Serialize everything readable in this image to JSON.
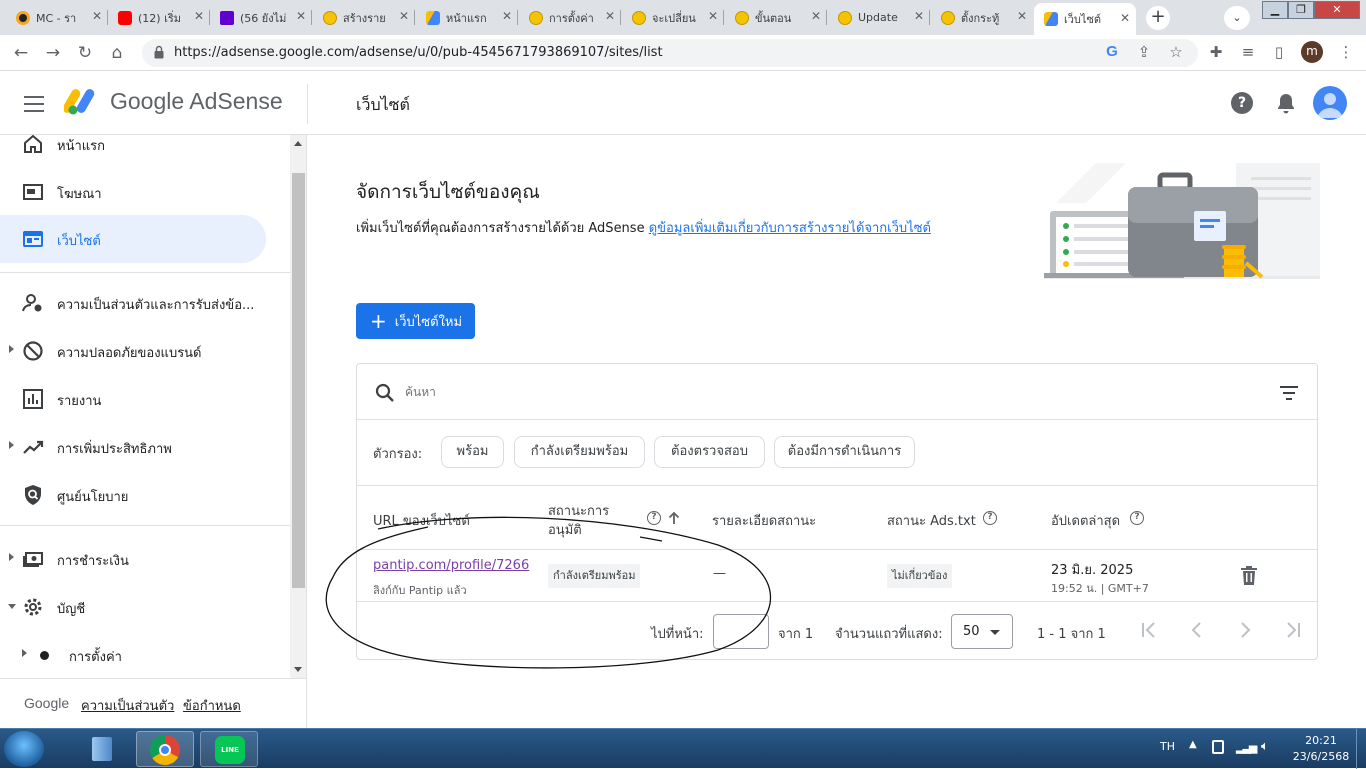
{
  "browser": {
    "tabs": [
      {
        "label": "MC - รา",
        "icon_color": "#222222"
      },
      {
        "label": "(12) เริ่ม",
        "icon_color": "#ff0000"
      },
      {
        "label": "(56 ยังไม่",
        "icon_color": "#6001d2"
      },
      {
        "label": "สร้างราย",
        "icon_color": "#f5c400"
      },
      {
        "label": "หน้าแรก",
        "icon_color": "#4285f4"
      },
      {
        "label": "การตั้งค่า",
        "icon_color": "#f5c400"
      },
      {
        "label": "จะเปลี่ยน",
        "icon_color": "#f5c400"
      },
      {
        "label": "ขั้นตอน",
        "icon_color": "#f5c400"
      },
      {
        "label": "Update",
        "icon_color": "#f5c400"
      },
      {
        "label": "ตั้งกระทู้",
        "icon_color": "#f5c400"
      },
      {
        "label": "เว็บไซต์",
        "icon_color": "#4285f4",
        "active": true
      }
    ],
    "new_tab": "+",
    "url": "https://adsense.google.com/adsense/u/0/pub-4545671793869107/sites/list",
    "profile_initial": "m"
  },
  "header": {
    "logo_text": "Google AdSense",
    "page_title": "เว็บไซต์"
  },
  "sidebar": {
    "items": [
      {
        "label": "หน้าแรก",
        "icon": "home-icon"
      },
      {
        "label": "โฆษณา",
        "icon": "ads-icon"
      },
      {
        "label": "เว็บไซต์",
        "icon": "sites-icon",
        "active": true
      },
      {
        "label": "ความเป็นส่วนตัวและการรับส่งข้อ...",
        "icon": "privacy-icon"
      },
      {
        "label": "ความปลอดภัยของแบรนด์",
        "icon": "block-icon"
      },
      {
        "label": "รายงาน",
        "icon": "reports-icon"
      },
      {
        "label": "การเพิ่มประสิทธิภาพ",
        "icon": "optimization-icon"
      },
      {
        "label": "ศูนย์นโยบาย",
        "icon": "policy-icon"
      },
      {
        "label": "การชำระเงิน",
        "icon": "payments-icon"
      },
      {
        "label": "บัญชี",
        "icon": "gear-icon"
      },
      {
        "label": "การตั้งค่า",
        "icon": "bullet-icon"
      }
    ],
    "footer": {
      "google": "Google",
      "privacy": "ความเป็นส่วนตัว",
      "terms": "ข้อกำหนด"
    }
  },
  "main": {
    "heading": "จัดการเว็บไซต์ของคุณ",
    "description": "เพิ่มเว็บไซต์ที่คุณต้องการสร้างรายได้ด้วย AdSense",
    "learn_more_link": "ดูข้อมูลเพิ่มเติมเกี่ยวกับการสร้างรายได้จากเว็บไซต์",
    "new_site_button": "เว็บไซต์ใหม่",
    "search_placeholder": "ค้นหา",
    "filters_label": "ตัวกรอง:",
    "filters": [
      "พร้อม",
      "กำลังเตรียมพร้อม",
      "ต้องตรวจสอบ",
      "ต้องมีการดำเนินการ"
    ],
    "columns": {
      "url": "URL ของเว็บไซต์",
      "approval_line1": "สถานะการ",
      "approval_line2": "อนุมัติ",
      "status_details": "รายละเอียดสถานะ",
      "ads_txt": "สถานะ Ads.txt",
      "last_updated": "อัปเดตล่าสุด"
    },
    "rows": [
      {
        "url": "pantip.com/profile/7266",
        "sub": "ลิงก์กับ Pantip แล้ว",
        "approval": "กำลังเตรียมพร้อม",
        "details": "—",
        "ads_txt": "ไม่เกี่ยวข้อง",
        "updated_date": "23 มิ.ย. 2025",
        "updated_time": "19:52 น. | GMT+7"
      }
    ],
    "pagination": {
      "goto_label": "ไปที่หน้า:",
      "of_pages": "จาก 1",
      "rows_label": "จำนวนแถวที่แสดง:",
      "rows_value": "50",
      "range": "1 - 1 จาก 1"
    }
  },
  "taskbar": {
    "lang": "TH",
    "time": "20:21",
    "date": "23/6/2568"
  },
  "colors": {
    "primary": "#1a73e8",
    "active_nav_bg": "#e8f0fe",
    "link_visited": "#7b3fa8"
  }
}
